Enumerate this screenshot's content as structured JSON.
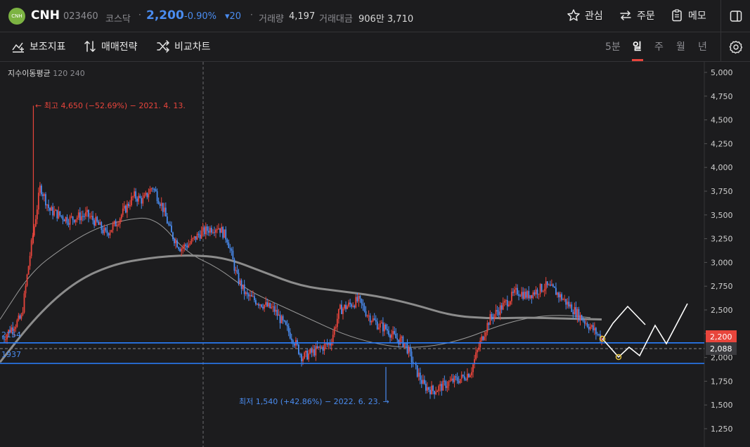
{
  "header": {
    "logo_text": "CNH",
    "name": "CNH",
    "code": "023460",
    "market": "코스닥",
    "price": "2,200",
    "change_rate": "-0.90%",
    "change_amount": "▾20",
    "volume_label": "거래량",
    "volume_value": "4,197",
    "amount_label": "거래대금",
    "amount_value": "906만 3,710",
    "actions": {
      "watch": "관심",
      "order": "주문",
      "memo": "메모"
    }
  },
  "toolbar": {
    "indicators": "보조지표",
    "strategy": "매매전략",
    "compare": "비교차트",
    "periods": [
      "5분",
      "일",
      "주",
      "월",
      "년"
    ],
    "active_period": "일"
  },
  "chart": {
    "ma_title": "지수이동평균",
    "ma_periods": "120 240",
    "high_annotation": "← 최고 4,650 (−52.69%) − 2021. 4. 13.",
    "low_annotation": "최저 1,540 (+42.86%) − 2022. 6. 23. →",
    "line_label_upper": "2154",
    "line_label_lower": "1937",
    "current_price_label": "2,200",
    "crosshair_price_label": "2,088",
    "colors": {
      "up": "#e8453c",
      "down": "#4a8cf0",
      "line": "#2a7fff",
      "ma_thick": "#8c8c8c",
      "ma_thin": "#9a9a9a"
    }
  },
  "chart_data": {
    "type": "candlestick",
    "title": "CNH 023460 일봉",
    "ylabel": "",
    "ylim": [
      1100,
      5100
    ],
    "y_ticks": [
      "5,000",
      "4,750",
      "4,500",
      "4,250",
      "4,000",
      "3,750",
      "3,500",
      "3,250",
      "3,000",
      "2,750",
      "2,500",
      "2,250",
      "2,000",
      "1,750",
      "1,500",
      "1,250"
    ],
    "highest": {
      "value": 4650,
      "date": "2021. 4. 13."
    },
    "lowest": {
      "value": 1540,
      "date": "2022. 6. 23."
    },
    "horizontal_lines": [
      2154,
      1937
    ],
    "current_price": 2200,
    "crosshair_price": 2088,
    "close_path": [
      2200,
      2320,
      2420,
      3150,
      3800,
      3550,
      3500,
      3450,
      3480,
      3500,
      3420,
      3300,
      3400,
      3550,
      3700,
      3650,
      3800,
      3600,
      3300,
      3150,
      3200,
      3300,
      3350,
      3380,
      3250,
      2850,
      2650,
      2600,
      2550,
      2500,
      2350,
      2200,
      2000,
      2050,
      2100,
      2150,
      2500,
      2550,
      2600,
      2450,
      2350,
      2300,
      2200,
      2150,
      1900,
      1700,
      1650,
      1700,
      1750,
      1780,
      1850,
      2150,
      2400,
      2500,
      2600,
      2700,
      2650,
      2700,
      2750,
      2700,
      2600,
      2500,
      2400,
      2300,
      2200
    ],
    "ma120": [
      2400,
      2900,
      3150,
      3350,
      3450,
      3480,
      3100,
      2950,
      2700,
      2550,
      2400,
      2250,
      2150,
      2100,
      2120,
      2200,
      2330,
      2420,
      2450,
      2420
    ],
    "ma240": [
      1950,
      2450,
      2800,
      2980,
      3050,
      3080,
      3050,
      2900,
      2750,
      2700,
      2650,
      2560,
      2440,
      2410,
      2420,
      2410,
      2400
    ]
  }
}
